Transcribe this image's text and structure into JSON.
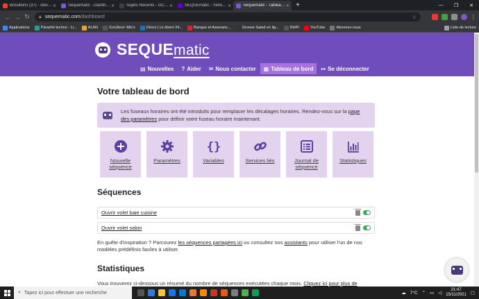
{
  "browser": {
    "tabs": [
      {
        "label": "Brouillons (37) - stevenalanteo@",
        "color": "#ea4335",
        "active": false
      },
      {
        "label": "Sequematic - Dashboard",
        "color": "#7a5cc4",
        "active": false
      },
      {
        "label": "Sujets Récents - GCE Electronics",
        "color": "#3c4043",
        "active": false
      },
      {
        "label": "SEQUEmatic - Yahoo Search - Ac",
        "color": "#6001d2",
        "active": false
      },
      {
        "label": "Sequematic - Tableau de bord",
        "color": "#7a5cc4",
        "active": true
      }
    ],
    "new_tab": "+",
    "url_host": "sequematic.com",
    "url_path": "/dashboard",
    "bookmarks": [
      {
        "label": "Applications",
        "color": "#4285f4"
      },
      {
        "label": "Parazhit techno - Li...",
        "color": "#2a9d8f"
      },
      {
        "label": "ALAN",
        "color": "#e9a23b"
      },
      {
        "label": "Son2teuf -Mix's",
        "color": "#555555"
      },
      {
        "label": "Direct | Le direct 24...",
        "color": "#1e73be"
      },
      {
        "label": "Banque et Assuranc...",
        "color": "#d62828"
      },
      {
        "label": "Groove Salad en lig...",
        "color": "#333333"
      },
      {
        "label": "RHPI",
        "color": "#555555"
      },
      {
        "label": "YouTube",
        "color": "#ff0000"
      },
      {
        "label": "Abonnez-vous",
        "color": "#777777"
      }
    ],
    "reading_list": "Liste de lecture"
  },
  "header": {
    "brand_main": "SEQUE",
    "brand_sub": "matic",
    "nav": [
      {
        "label": "Nouvelles",
        "icon": "▤",
        "icon_name": "newspaper-icon",
        "active": false
      },
      {
        "label": "Aider",
        "icon": "?",
        "icon_name": "help-icon",
        "active": false
      },
      {
        "label": "Nous contacter",
        "icon": "✉",
        "icon_name": "envelope-icon",
        "active": false
      },
      {
        "label": "Tableau de bord",
        "icon": "▦",
        "icon_name": "dashboard-icon",
        "active": true
      },
      {
        "label": "Se déconnecter",
        "icon": "↦",
        "icon_name": "logout-icon",
        "active": false
      }
    ]
  },
  "main": {
    "title": "Votre tableau de bord",
    "alert": {
      "before": "Les fuseaux horaires ont été introduits pour remplacer les décalages horaires. Rendez-vous sur la ",
      "link": "page des paramètres",
      "after": " pour définir votre fuseau horaire maintenant."
    },
    "tiles": [
      {
        "label": "Nouvelle séquence",
        "icon_name": "plus-circle-icon"
      },
      {
        "label": "Paramètres",
        "icon_name": "gear-icon"
      },
      {
        "label": "Variables",
        "icon_name": "braces-icon"
      },
      {
        "label": "Services liés",
        "icon_name": "link-icon"
      },
      {
        "label": "Journal de séquence",
        "icon_name": "list-icon"
      },
      {
        "label": "Statistiques",
        "icon_name": "bar-chart-icon"
      }
    ],
    "sequences_title": "Séquences",
    "sequences": [
      {
        "label": "Ouvrir volet baie cuisine",
        "enabled": true
      },
      {
        "label": "Ouvrir volet salon",
        "enabled": true
      }
    ],
    "inspire": {
      "before": "En quête d'inspiration ? Parcourez ",
      "link1": "les séquences partagées ici",
      "mid": " ou consultez nos ",
      "link2": "assistants",
      "after": " pour utiliser l'un de nos modèles prédéfinis faciles à utiliser."
    },
    "stats_title": "Statistiques",
    "stats_text": {
      "before": "Vous trouverez ci-dessous un résumé du nombre de séquences exécutées chaque mois. ",
      "link": "Cliquez ici pour plus de"
    }
  },
  "taskbar": {
    "search_placeholder": "Tapez ici pour effectuer une recherche",
    "weather": "7°C",
    "time": "21:47",
    "date": "15/11/2021"
  },
  "colors": {
    "brand": "#6f4dbb",
    "tile": "#e4d3ee",
    "accent": "#a771e0",
    "icon": "#5b3fa3"
  }
}
